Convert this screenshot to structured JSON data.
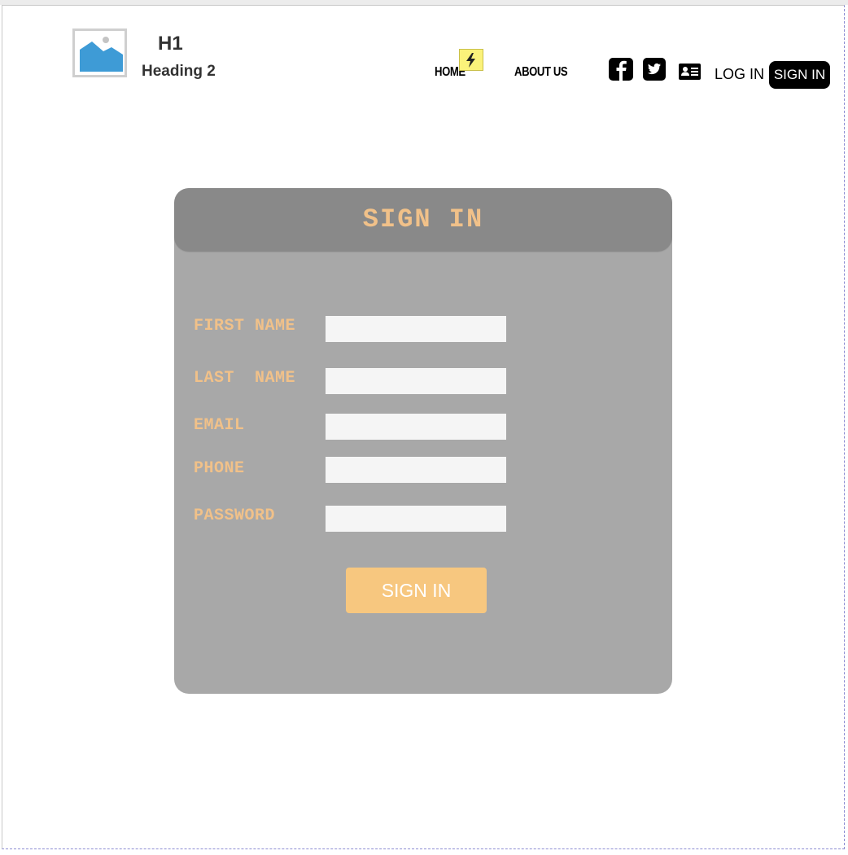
{
  "header": {
    "h1": "H1",
    "h2": "Heading 2",
    "nav": {
      "home": "HOME",
      "about": "ABOUT US"
    },
    "login": "LOG IN",
    "signin": "SIGN IN"
  },
  "icons": {
    "logo": "image-placeholder-icon",
    "badge": "lightning-bolt-icon",
    "facebook": "facebook-icon",
    "twitter": "twitter-icon",
    "contact": "contact-card-icon"
  },
  "form": {
    "title": "SIGN IN",
    "fields": [
      {
        "label": "FIRST NAME",
        "value": ""
      },
      {
        "label": "LAST  NAME",
        "value": ""
      },
      {
        "label": "EMAIL",
        "value": ""
      },
      {
        "label": "PHONE",
        "value": ""
      },
      {
        "label": "PASSWORD",
        "value": ""
      }
    ],
    "submit": "SIGN IN"
  },
  "colors": {
    "panel": "#a8a8a8",
    "panel_header": "#898989",
    "label_text": "#f1c189",
    "accent_button": "#f7c77f",
    "input_bg": "#f5f5f5",
    "pill_bg": "#000000"
  }
}
